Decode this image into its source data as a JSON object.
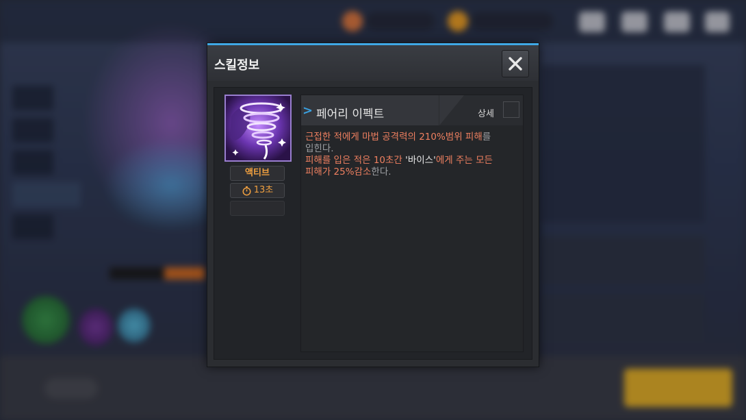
{
  "dialog": {
    "title": "스킬정보",
    "close_icon": "close-icon"
  },
  "skill": {
    "name": "페어리 이펙트",
    "type": "액티브",
    "cooldown": "13초",
    "detail_label": "상세",
    "icon": "purple-tornado-skill-icon",
    "description": {
      "line1_a": "근접한 적에게 마법 공격력의 210%범위 피해",
      "line1_b": "를",
      "line2": "입힌다.",
      "line3_a": "피해를 입은 적은 10초간 ",
      "line3_b": "'바이스'",
      "line3_c": "에게 주는 모든",
      "line4_a": "피해가 25%감소",
      "line4_b": "한다."
    }
  },
  "colors": {
    "accent": "#3fa9e6",
    "highlight": "#f08060",
    "badge_text": "#f0a040"
  }
}
